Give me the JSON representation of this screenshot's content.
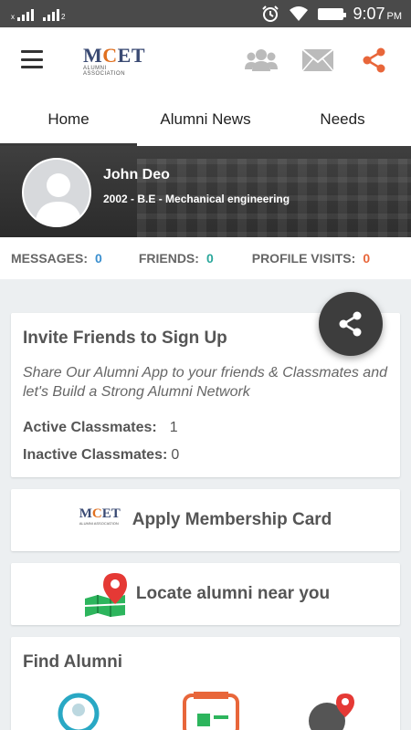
{
  "status_bar": {
    "time": "9:07",
    "ampm": "PM",
    "icons": [
      "signal-x-icon",
      "signal-2-icon",
      "alarm-icon",
      "wifi-icon",
      "battery-icon"
    ]
  },
  "app_bar": {
    "logo": {
      "text_m": "M",
      "text_c": "C",
      "text_et": "ET",
      "subtitle": "ALUMNI ASSOCIATION"
    },
    "icons": [
      "menu-icon",
      "friends-icon",
      "mail-icon",
      "share-icon"
    ],
    "colors": {
      "share": "#e8663a",
      "muted": "#bbbbbb"
    }
  },
  "tabs": [
    {
      "label": "Home",
      "active": true
    },
    {
      "label": "Alumni News",
      "active": false
    },
    {
      "label": "Needs",
      "active": false
    }
  ],
  "profile": {
    "name": "John Deo",
    "degree": "2002 - B.E - Mechanical engineering"
  },
  "stats": {
    "messages_label": "MESSAGES:",
    "messages_value": "0",
    "friends_label": "FRIENDS:",
    "friends_value": "0",
    "visits_label": "PROFILE VISITS:",
    "visits_value": "0"
  },
  "invite_card": {
    "title": "Invite Friends to Sign Up",
    "description": "Share Our Alumni App to your friends & Classmates and let's Build a Strong Alumni Network",
    "active_label": "Active Classmates:",
    "active_value": "1",
    "inactive_label": "Inactive Classmates:",
    "inactive_value": "0"
  },
  "membership_card": {
    "label": "Apply Membership Card"
  },
  "locate_card": {
    "label": "Locate alumni near you"
  },
  "find_alumni": {
    "title": "Find Alumni"
  }
}
